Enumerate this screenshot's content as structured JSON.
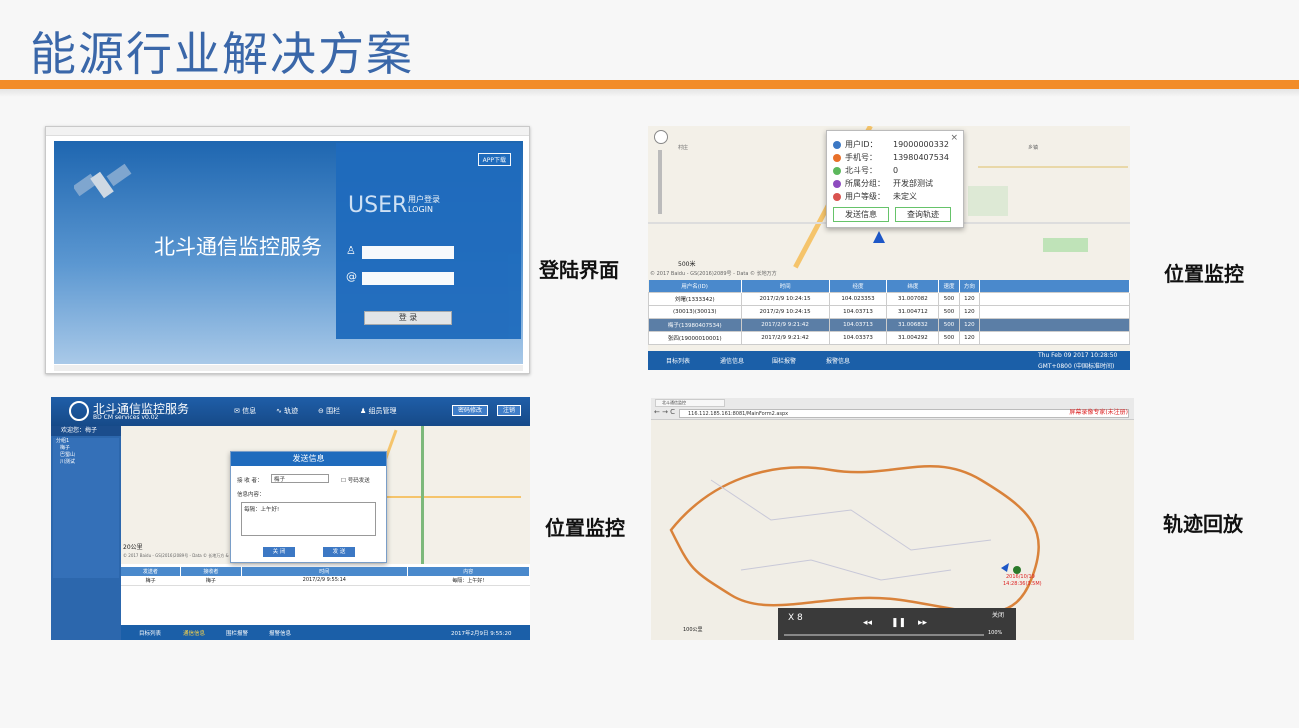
{
  "slide": {
    "title": "能源行业解决方案",
    "accent": "#f28c28",
    "title_color": "#3a67a9"
  },
  "captions": {
    "login": "登陆界面",
    "monitor1": "位置监控",
    "monitor2": "位置监控",
    "track": "轨迹回放"
  },
  "login": {
    "service_title": "北斗通信监控服务",
    "user": "USER",
    "login_cn": "用户登录",
    "login_en": "LOGIN",
    "app_download": "APP下载",
    "submit": "登 录"
  },
  "monitor_top": {
    "popup": {
      "rows": [
        {
          "label": "用户ID：",
          "value": "19000000332",
          "color": "#3c78c4"
        },
        {
          "label": "手机号：",
          "value": "13980407534",
          "color": "#e8702a"
        },
        {
          "label": "北斗号：",
          "value": "0",
          "color": "#5cb85c"
        },
        {
          "label": "所属分组：",
          "value": "开发部测试",
          "color": "#8e4bbf"
        },
        {
          "label": "用户等级：",
          "value": "未定义",
          "color": "#d9534f"
        }
      ],
      "btn_send": "发送信息",
      "btn_track": "查询轨迹",
      "close": "×"
    },
    "scale": "500米",
    "copyright": "© 2017 Baidu - GS(2016)2089号 - Data © 长地万方",
    "columns": [
      "用户名(ID)",
      "时间",
      "经度",
      "纬度",
      "速度",
      "方向"
    ],
    "rows": [
      [
        "刘曙(1333342)",
        "2017/2/9 10:24:15",
        "104.023353",
        "31.007082",
        "500",
        "120"
      ],
      [
        "(30013)(30013)",
        "2017/2/9 10:24:15",
        "104.03713",
        "31.004712",
        "500",
        "120"
      ],
      [
        "梅子(13980407534)",
        "2017/2/9 9:21:42",
        "104.03713",
        "31.006832",
        "500",
        "120"
      ],
      [
        "张四(19000010001)",
        "2017/2/9 9:21:42",
        "104.03373",
        "31.004292",
        "500",
        "120"
      ]
    ],
    "footer": [
      "目标列表",
      "通信信息",
      "围栏报警",
      "报警信息"
    ],
    "time_line1": "Thu Feb 09 2017 10:28:50",
    "time_line2": "GMT+0800 (中国标准时间)"
  },
  "app": {
    "title": "北斗通信监控服务",
    "subtitle": "BD CM services v0.02",
    "nav": [
      "信息",
      "轨迹",
      "围栏",
      "组员管理"
    ],
    "header_buttons": [
      "密码修改",
      "注销"
    ],
    "welcome": "欢迎您：梅子",
    "tree": [
      "分组1",
      "梅子",
      "巴蜀山",
      "川测试"
    ],
    "dialog": {
      "title": "发送信息",
      "receiver_label": "接 收 者：",
      "receiver_value": "梅子",
      "checkbox": "号码发送",
      "content_label": "信息内容：",
      "content": "每隔：上午好!",
      "close": "关 闭",
      "send": "发 送"
    },
    "scale": "20公里",
    "copyright": "© 2017 Baidu - GS(2016)2089号 - Data © 长地万方 & Auto",
    "columns": [
      "发送者",
      "接收者",
      "时间",
      "内容"
    ],
    "rows": [
      [
        "梅子",
        "梅子",
        "2017/2/9 9:55:14",
        "每隔：上午好!"
      ]
    ],
    "footer": [
      "目标列表",
      "通信信息",
      "围栏报警",
      "报警信息"
    ],
    "time": "2017年2月9日 9:55:20"
  },
  "track": {
    "tab": "北斗通信监控",
    "url": "116.112.185.161:8081/MainForm2.aspx",
    "right_text": "屏幕录像专家(未注册)",
    "speed": "X 8",
    "close": "关闭",
    "percent": "100%",
    "marker_date": "2016/10/19",
    "marker_time": "14:28:36(3.5M)",
    "scale": "100公里"
  }
}
